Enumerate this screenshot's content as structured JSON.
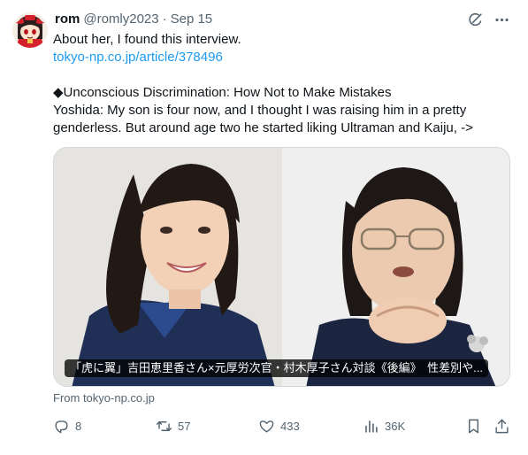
{
  "tweet": {
    "author_name": "rom",
    "handle": "@romly2023",
    "separator": "·",
    "timestamp": "Sep 15",
    "text_line1": "About her, I found this interview.",
    "link": "tokyo-np.co.jp/article/378496",
    "text_line3": "◆Unconscious Discrimination: How Not to Make Mistakes",
    "text_line4": "Yoshida: My son is four now, and I thought I was raising him in a pretty",
    "text_line5": "genderless. But around age two he started liking Ultraman and Kaiju, ->"
  },
  "card": {
    "caption": "「虎に翼」吉田恵里香さん×元厚労次官・村木厚子さん対談《後編》　性差別や...",
    "source": "From tokyo-np.co.jp"
  },
  "actions": {
    "replies": "8",
    "reposts": "57",
    "likes": "433",
    "views": "36K"
  },
  "icons": {
    "top": [
      "grok-icon",
      "more-icon"
    ],
    "action_bar": [
      "reply-icon",
      "repost-icon",
      "like-icon",
      "views-icon",
      "bookmark-icon",
      "share-icon"
    ],
    "link_color": "#1d9bf0",
    "muted_color": "#536471"
  }
}
